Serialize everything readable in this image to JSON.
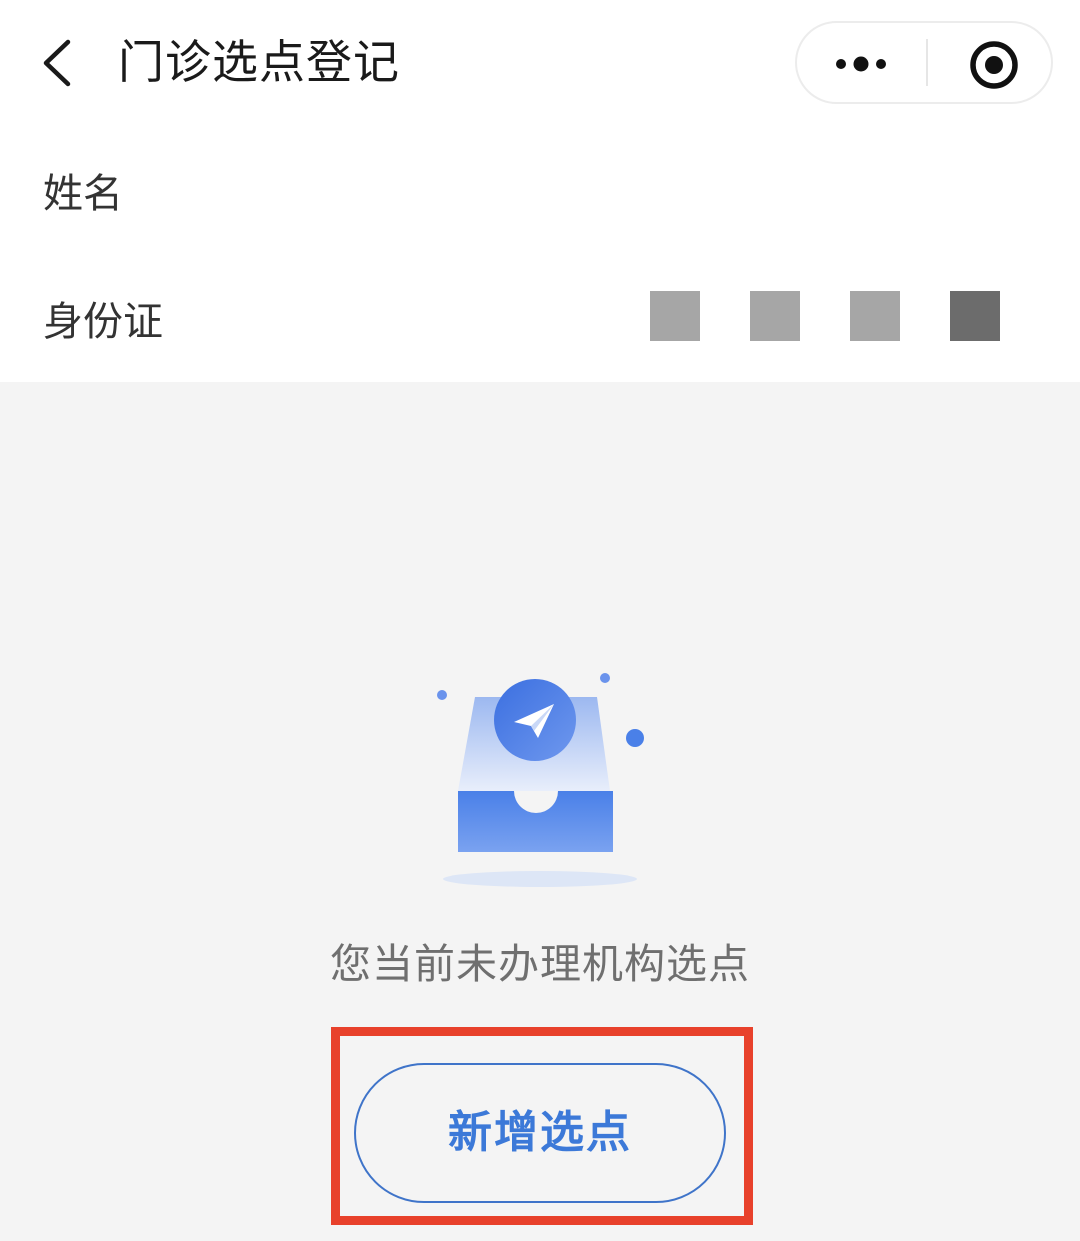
{
  "header": {
    "title": "门诊选点登记",
    "back_icon": "chevron-left-icon",
    "more_icon": "more-dots-icon",
    "close_icon": "target-circle-icon"
  },
  "profile": {
    "name_label": "姓名",
    "name_value": "",
    "id_label": "身份证",
    "id_value_masked": "redacted"
  },
  "empty_state": {
    "illustration_icon": "inbox-paper-plane-icon",
    "message": "您当前未办理机构选点"
  },
  "actions": {
    "add_label": "新增选点"
  },
  "colors": {
    "accent": "#3c79d8",
    "highlight": "#e8412b",
    "background": "#f4f4f4"
  }
}
